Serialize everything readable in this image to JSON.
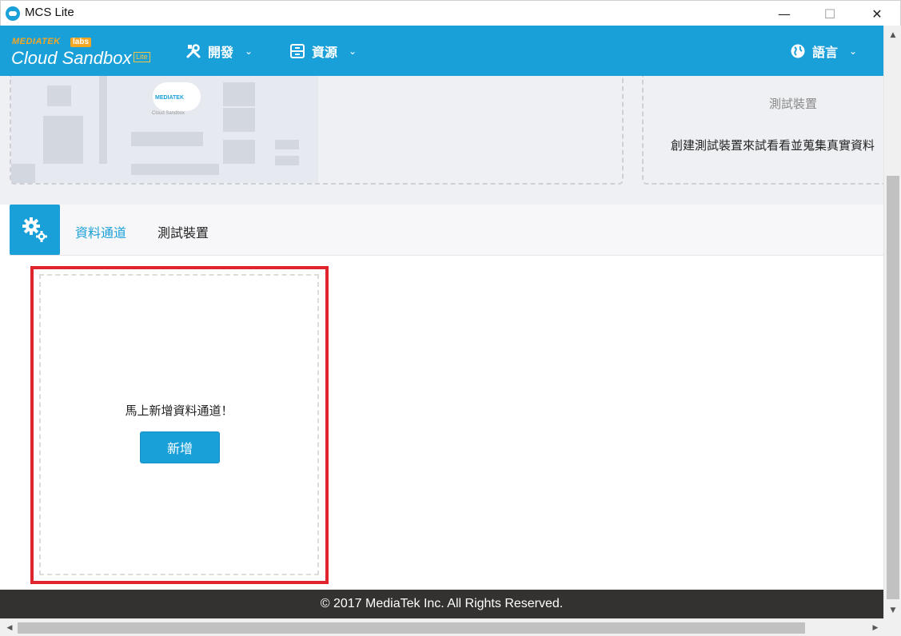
{
  "window": {
    "title": "MCS Lite",
    "minimize": "—",
    "maximize": "☐",
    "close": "✕"
  },
  "header": {
    "logo_brand": "MEDIATEK",
    "logo_labs": "labs",
    "logo_main": "Cloud Sandbox",
    "logo_badge": "Lite",
    "nav": {
      "develop": "開發",
      "resources": "資源",
      "language": "語言"
    },
    "chevron": "⌄"
  },
  "banner": {
    "board_logo": "MEDIATEK",
    "board_sub": "Cloud Sandbox",
    "right_title": "測試裝置",
    "right_desc": "創建測試裝置來試看看並蒐集真實資料"
  },
  "tabs": {
    "channel": "資料通道",
    "device": "測試裝置"
  },
  "add_panel": {
    "prompt": "馬上新增資料通道！",
    "button": "新增"
  },
  "footer": {
    "copyright": "© 2017 MediaTek Inc. All Rights Reserved."
  },
  "colors": {
    "primary": "#1aa0d8",
    "highlight": "#e0242c",
    "footer_bg": "#333230",
    "accent": "#f5a623"
  }
}
